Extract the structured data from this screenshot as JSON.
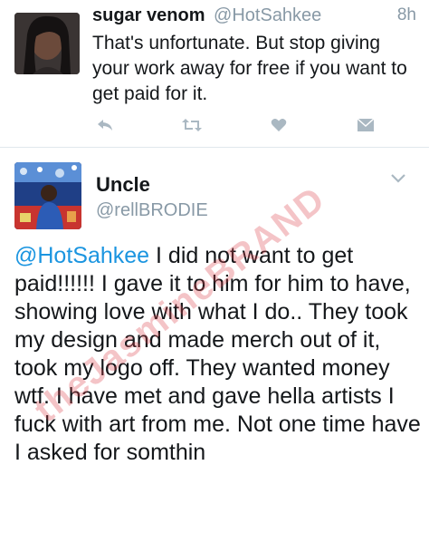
{
  "tweet1": {
    "name": "sugar venom",
    "handle": "@HotSahkee",
    "time": "8h",
    "text": "That's unfortunate. But stop giving your work away for free if you want to get paid for it.",
    "actions": [
      "reply-icon",
      "retweet-icon",
      "like-icon",
      "message-icon"
    ]
  },
  "tweet2": {
    "name": "Uncle",
    "handle": "@rellBRODIE",
    "mention": "@HotSahkee",
    "text": " I did not want to get paid!!!!!! I gave it to him for him to have, showing love with what I do.. They took my design and made merch out of it, took my logo off. They wanted money wtf. I have met and gave hella artists I fuck with art from me. Not one time have I asked for somthin"
  },
  "watermark": "theJasmineBRAND",
  "colors": {
    "link": "#1b95e0",
    "muted": "#8899a6",
    "text": "#14171a",
    "icon": "#aab8c2"
  }
}
